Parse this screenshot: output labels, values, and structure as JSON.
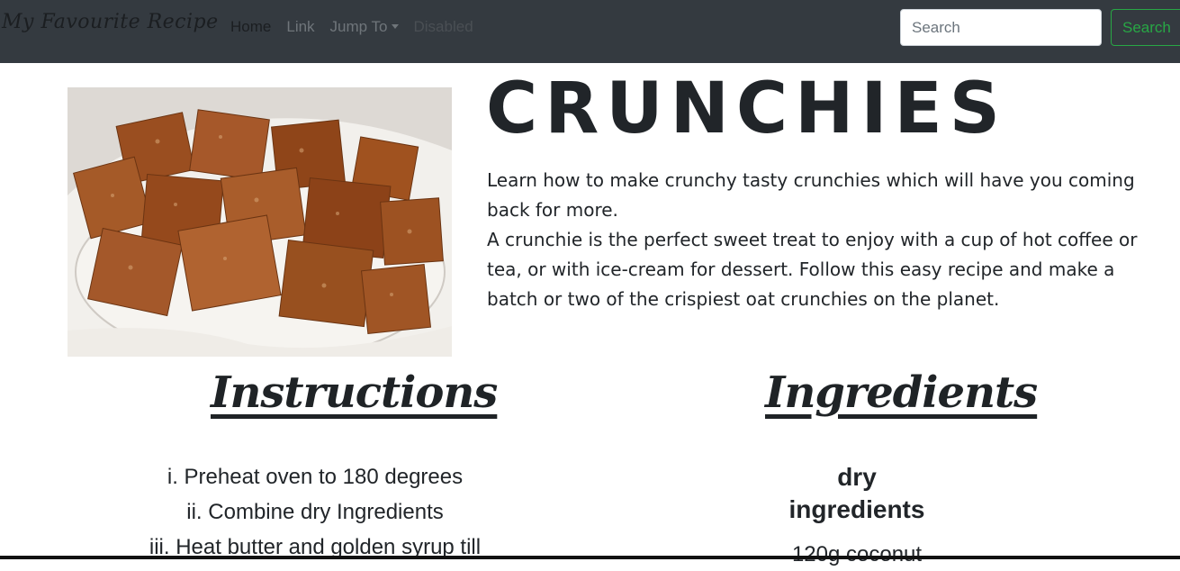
{
  "navbar": {
    "brand": "My Favourite Recipe",
    "links": [
      {
        "label": "Home",
        "state": "active"
      },
      {
        "label": "Link",
        "state": "normal"
      },
      {
        "label": "Jump To",
        "state": "dropdown"
      },
      {
        "label": "Disabled",
        "state": "disabled"
      }
    ],
    "search": {
      "placeholder": "Search",
      "button_label": "Search"
    }
  },
  "hero": {
    "image": {
      "subject": "crunchies oat bars in a paper-lined bowl"
    },
    "title": "CRUNCHIES",
    "intro": [
      "Learn how to make crunchy tasty crunchies which will have you coming back for more.",
      "A crunchie is the perfect sweet treat to enjoy with a cup of hot coffee or tea, or with ice-cream for dessert. Follow this easy recipe and make a batch or two of the crispiest oat crunchies on the planet."
    ]
  },
  "instructions": {
    "heading": "Instructions",
    "steps": [
      "i. Preheat oven to 180 degrees",
      "ii. Combine dry Ingredients",
      "iii. Heat butter and golden syrup till"
    ]
  },
  "ingredients": {
    "heading": "Ingredients",
    "group_label": "dry ingredients",
    "items": [
      "120g coconut"
    ]
  },
  "colors": {
    "navbar_bg": "#343a40",
    "success": "#28a745",
    "text": "#212529"
  }
}
